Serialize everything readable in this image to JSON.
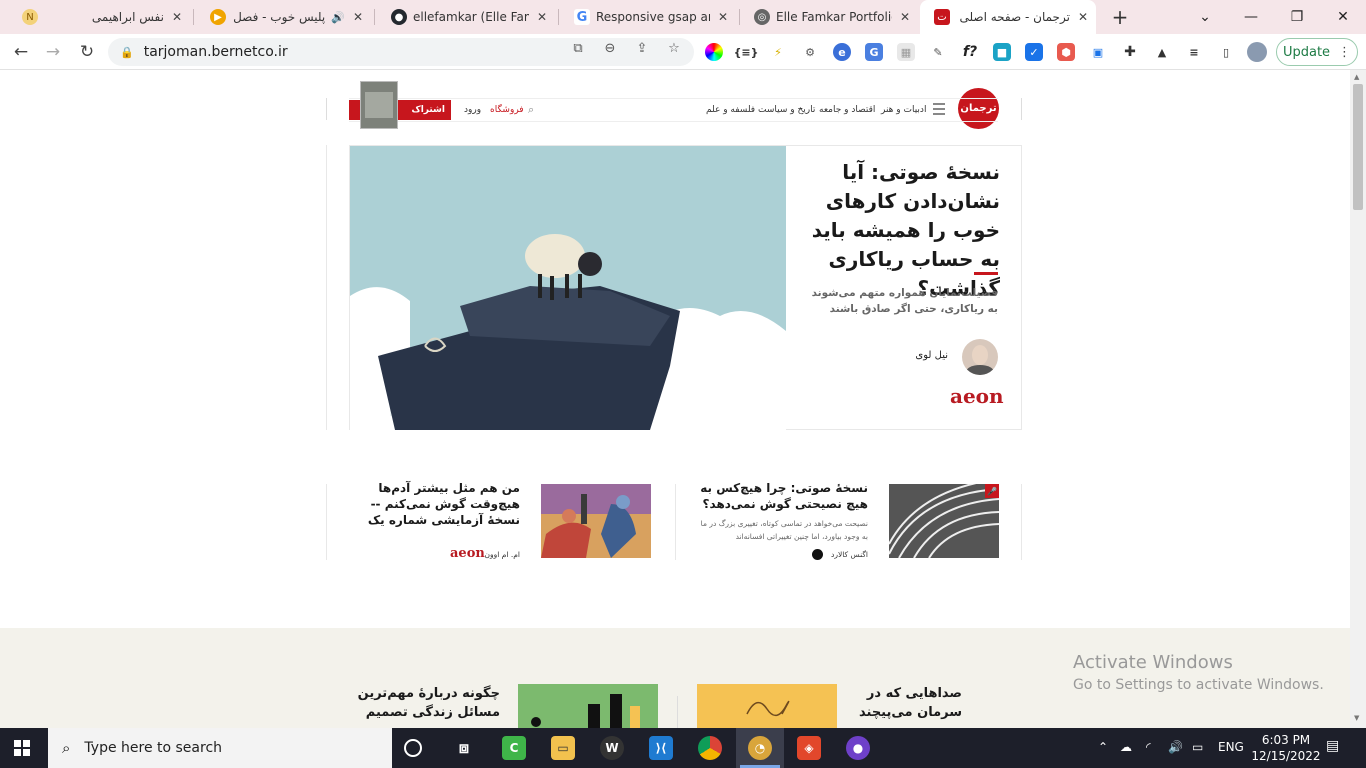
{
  "browser": {
    "tabs": [
      {
        "title": "نفس ابراهیمی",
        "favicon": "note-favicon",
        "color": "#e7a321",
        "active": false
      },
      {
        "title": "پلیس خوب - فصل",
        "favicon": "play-favicon",
        "color": "#f0a400",
        "active": false,
        "audio": true
      },
      {
        "title": "ellefamkar (Elle Famka",
        "favicon": "github-favicon",
        "color": "#24292f",
        "active": false
      },
      {
        "title": "Responsive gsap anim",
        "favicon": "google-favicon",
        "color": "#4285f4",
        "active": false
      },
      {
        "title": "Elle Famkar Portfolio |",
        "favicon": "globe-favicon",
        "color": "#555555",
        "active": false
      },
      {
        "title": "ترجمان - صفحه اصلی",
        "favicon": "tarjoman-favicon",
        "color": "#c7161d",
        "active": true
      }
    ],
    "new_tab_label": "+",
    "url": "tarjoman.bernetco.ir",
    "update_label": "Update"
  },
  "site": {
    "logo_text": "ترجمان",
    "nav": [
      "ادبیات و هنر",
      "اقتصاد و جامعه",
      "تاریخ و سیاست",
      "فلسفه و علم"
    ],
    "shop": "فروشگاه",
    "login": "ورود",
    "subscribe": "اشتراک"
  },
  "hero": {
    "title": "نسخهٔ صوتی: آیا نشان‌دادن کارهای خوب را همیشه باید به حساب ریاکاری گذاشت؟",
    "subtitle": "فضیلت‌نمایان همواره متهم می‌شوند به ریاکاری، حتی اگر صادق باشند",
    "author": "نیل لوی",
    "source": "aeon"
  },
  "cards": [
    {
      "title": "نسخهٔ صوتی: چرا هیچ‌کس به هیچ نصیحتی گوش نمی‌دهد؟",
      "desc": "نصیحت می‌خواهد در تماسی کوتاه، تغییری بزرگ در ما به وجود بیاورد، اما چنین تغییراتی افسانه‌اند",
      "author": "اگنس کالارد"
    },
    {
      "title": "من هم مثل بیشتر آدم‌ها هیچ‌وقت گوش نمی‌کنم -- نسخهٔ آزمایشی شماره یک",
      "author": "ام. ام اوون",
      "source": "aeon"
    }
  ],
  "lower": [
    {
      "title": "صداهایی که در سرمان می‌پیچند و"
    },
    {
      "title": "چگونه دربارهٔ مهم‌ترین مسائل زندگی تصمیم"
    }
  ],
  "watermark": {
    "line1": "Activate Windows",
    "line2": "Go to Settings to activate Windows."
  },
  "taskbar": {
    "search_placeholder": "Type here to search",
    "lang": "ENG",
    "time": "6:03 PM",
    "date": "12/15/2022"
  }
}
